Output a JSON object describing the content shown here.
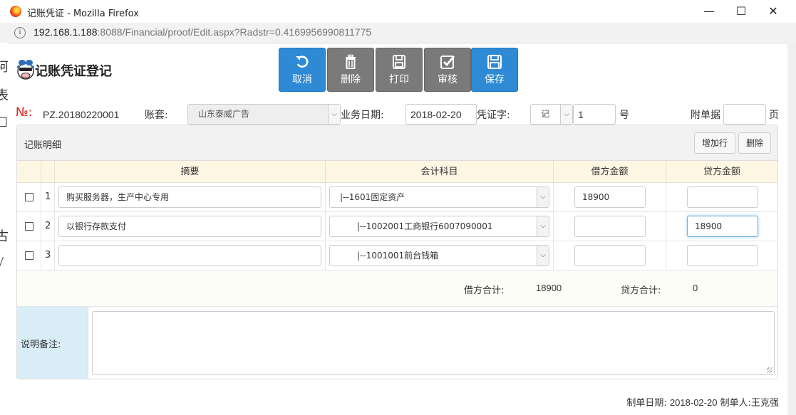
{
  "window": {
    "title": "记账凭证 - Mozilla Firefox",
    "url_host": "192.168.1.188",
    "url_rest": ":8088/Financial/proof/Edit.aspx?Radstr=0.4169956990811775"
  },
  "app": {
    "title": "记账凭证登记"
  },
  "toolbar": {
    "cancel_label": "取消",
    "delete_label": "删除",
    "print_label": "打印",
    "audit_label": "审核",
    "save_label": "保存"
  },
  "form": {
    "no_label": "№:",
    "no_value": "PZ.20180220001",
    "account_set_label": "账套:",
    "account_set_value": "山东泰威广告",
    "biz_date_label": "业务日期:",
    "biz_date_value": "2018-02-20",
    "voucher_word_label": "凭证字:",
    "voucher_word_value": "记",
    "voucher_num_value": "1",
    "number_suffix": "号",
    "attachments_label": "附单据",
    "attachments_value": "",
    "attachments_suffix": "页"
  },
  "details": {
    "title": "记账明细",
    "add_row_label": "增加行",
    "delete_label": "删除",
    "columns": [
      "摘要",
      "会计科目",
      "借方金额",
      "贷方金额"
    ],
    "rows": [
      {
        "num": "1",
        "summary": "购买服务器，生产中心专用",
        "account": "|--1601固定资产",
        "debit": "18900",
        "credit": ""
      },
      {
        "num": "2",
        "summary": "以银行存款支付",
        "account": "|--1002001工商银行6007090001",
        "debit": "",
        "credit": "18900"
      },
      {
        "num": "3",
        "summary": "",
        "account": "|--1001001前台钱箱",
        "debit": "",
        "credit": ""
      }
    ],
    "debit_total_label": "借方合计:",
    "debit_total_value": "18900",
    "credit_total_label": "贷方合计:",
    "credit_total_value": "0",
    "notes_label": "说明备注:",
    "notes_value": ""
  },
  "footer": {
    "made_date_label": "制单日期:",
    "made_date_value": "2018-02-20",
    "maker_label": "制单人:",
    "maker_value": "王克强"
  },
  "colors": {
    "primary_button": "#2e8ad4",
    "secondary_button": "#7a7a7a",
    "no_label": "#e02020",
    "table_header": "#fdf6e3",
    "notes_label_bg": "#d9edf7"
  },
  "icons": {
    "cancel": "undo-icon",
    "delete": "trash-icon",
    "print": "print-icon",
    "audit": "checkbox-icon",
    "save": "save-icon"
  }
}
